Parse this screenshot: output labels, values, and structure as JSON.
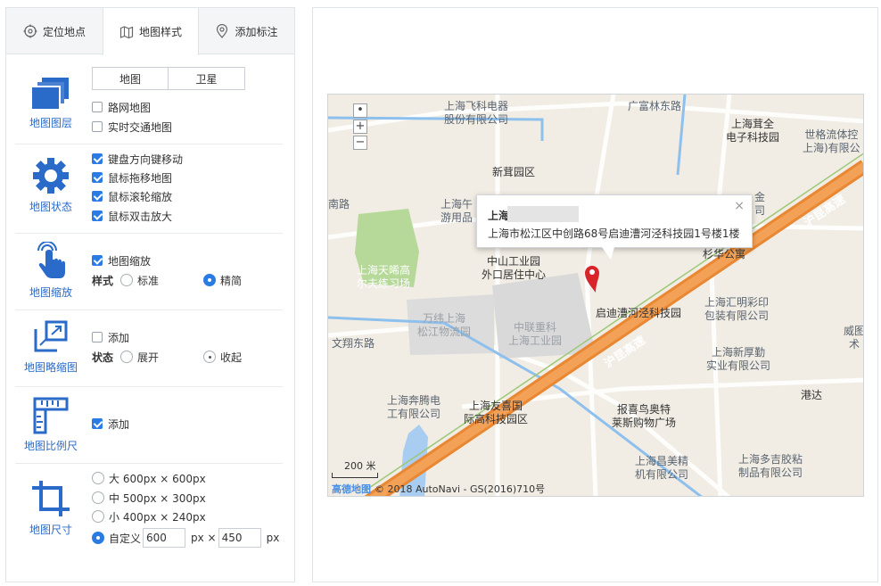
{
  "tabs": [
    {
      "label": "定位地点"
    },
    {
      "label": "地图样式"
    },
    {
      "label": "添加标注"
    }
  ],
  "layer": {
    "label": "地图图层",
    "segments": [
      "地图",
      "卫星"
    ],
    "options": [
      "路网地图",
      "实时交通地图"
    ]
  },
  "state": {
    "label": "地图状态",
    "options": [
      "键盘方向键移动",
      "鼠标拖移地图",
      "鼠标滚轮缩放",
      "鼠标双击放大"
    ]
  },
  "zoom": {
    "label": "地图缩放",
    "option": "地图缩放",
    "style_label": "样式",
    "style_options": [
      "标准",
      "精简"
    ]
  },
  "overview": {
    "label": "地图略缩图",
    "option": "添加",
    "state_label": "状态",
    "state_options": [
      "展开",
      "收起"
    ]
  },
  "scale": {
    "label": "地图比例尺",
    "option": "添加"
  },
  "size": {
    "label": "地图尺寸",
    "options": [
      "大 600px × 600px",
      "中 500px × 300px",
      "小 400px × 240px"
    ],
    "custom_label": "自定义",
    "custom_width": "600",
    "custom_height": "450",
    "unit_px": "px",
    "times": "px ×"
  },
  "map": {
    "info_title": "上海",
    "info_address": "上海市松江区中创路68号启迪漕河泾科技园1号楼1楼",
    "info_close": "×",
    "scale_text": "200 米",
    "copyright_logo": "高德地图",
    "copyright": "© 2018 AutoNavi - GS(2016)710号",
    "zoom_in": "+",
    "zoom_out": "−",
    "road_1": "沪昆高速",
    "road_2": "沪昆高速",
    "labels": {
      "feike": "上海飞科电器\n股份有限公司",
      "fulin": "广富林东路",
      "rongquan": "上海茸全\n电子科技园",
      "shige": "世格流体控\n上海)有限公",
      "xinrong": "新茸园区",
      "nanlu": "南路",
      "wuyou": "上海午\n游用品",
      "jin": "金\n司",
      "tianxi": "上海天晞高\n尔夫练习场",
      "zhongshan": "中山工业园\n外口居住中心",
      "shanhua": "杉华公寓",
      "qidi": "启迪漕河泾科技园",
      "huiming": "上海汇明彩印\n包装有限公司",
      "wanwei": "万纬上海\n松江物流园",
      "zhonglian": "中联重科\n上海工业园",
      "weiyi": "威图\n术",
      "wenxiang": "文翔东路",
      "xinhou": "上海新厚勤\n实业有限公司",
      "benteng": "上海奔腾电\n工有限公司",
      "youxi": "上海友喜国\n际高科技园区",
      "baoxi": "报喜鸟奥特\n莱斯购物广场",
      "gangda": "港达",
      "changmei": "上海昌美精\n机有限公司",
      "duoji": "上海多吉胶粘\n制品有限公司",
      "lu": "路"
    }
  },
  "colors": {
    "accent": "#2a7be4",
    "label_blue": "#2a6bc9",
    "highway": "#f08a3e",
    "park": "#b6d99a",
    "water": "#a9cdf0"
  }
}
